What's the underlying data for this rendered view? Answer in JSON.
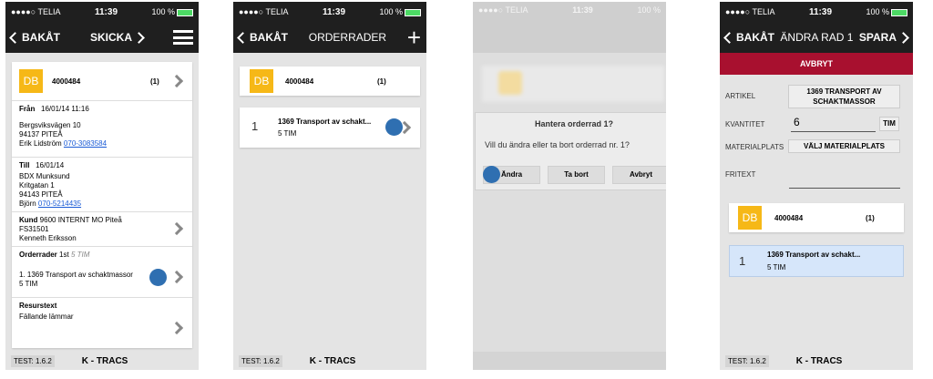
{
  "status": {
    "carrier": "●●●●○ TELIA",
    "time": "11:39",
    "battery": "100 %"
  },
  "footer": {
    "version": "TEST: 1.6.2",
    "brand": "K - TRACS"
  },
  "s1": {
    "back": "BAKÅT",
    "action": "SKICKA",
    "db": "DB",
    "order": "4000484",
    "count": "(1)",
    "from_label": "Från",
    "from_date": "16/01/14 11:16",
    "from_addr1": "Bergsviksvägen 10",
    "from_addr2": "94137 PITEÅ",
    "from_contact": "Erik Lidström",
    "from_phone": "070-3083584",
    "to_label": "Till",
    "to_date": "16/01/14",
    "to_addr1": "BDX Munksund",
    "to_addr2": "Kritgatan 1",
    "to_addr3": "94143 PITEÅ",
    "to_contact": "Björn",
    "to_phone": "070-5214435",
    "kund_label": "Kund",
    "kund_value": "9600 INTERNT MO Piteå",
    "kund_line2": "FS31501",
    "kund_line3": "Kenneth Eriksson",
    "orderrader_label": "Orderrader",
    "orderrader_count": "1st",
    "orderrader_unit": "5 TIM",
    "orderrad_item": "1. 1369 Transport av schaktmassor",
    "orderrad_qty": "5 TIM",
    "resurs_label": "Resurstext",
    "resurs_value": "Fällande lämmar"
  },
  "s2": {
    "back": "BAKÅT",
    "title": "ORDERRADER",
    "db": "DB",
    "order": "4000484",
    "count": "(1)",
    "row_num": "1",
    "row_title": "1369 Transport av schakt...",
    "row_qty": "5 TIM"
  },
  "s3": {
    "carrier": "●●●●○ TELIA",
    "time": "11:39",
    "battery": "100 %",
    "dialog_title": "Hantera orderrad 1?",
    "dialog_msg": "Vill du ändra eller ta bort orderrad nr. 1?",
    "btn_edit": "Ändra",
    "btn_delete": "Ta bort",
    "btn_cancel": "Avbryt"
  },
  "s4": {
    "back": "BAKÅT",
    "title": "ÄNDRA RAD 1",
    "save": "SPARA",
    "cancel": "AVBRYT",
    "artikel_label": "ARTIKEL",
    "artikel_value": "1369 TRANSPORT AV SCHAKTMASSOR",
    "kvantitet_label": "KVANTITET",
    "kvantitet_value": "6",
    "unit": "TIM",
    "material_label": "MATERIALPLATS",
    "material_btn": "VÄLJ MATERIALPLATS",
    "fritext_label": "FRITEXT",
    "db": "DB",
    "order": "4000484",
    "count": "(1)",
    "row_num": "1",
    "row_title": "1369 Transport av schakt...",
    "row_qty": "5 TIM"
  }
}
